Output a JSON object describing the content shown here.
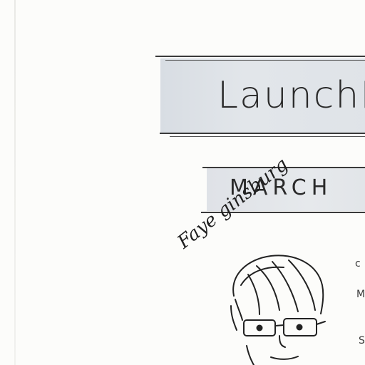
{
  "banner": {
    "title": "LaunchPa",
    "date": "MARCH"
  },
  "portrait": {
    "signature": "Faye ginsburg"
  },
  "margin_notes": [
    "c",
    "M",
    "S"
  ]
}
